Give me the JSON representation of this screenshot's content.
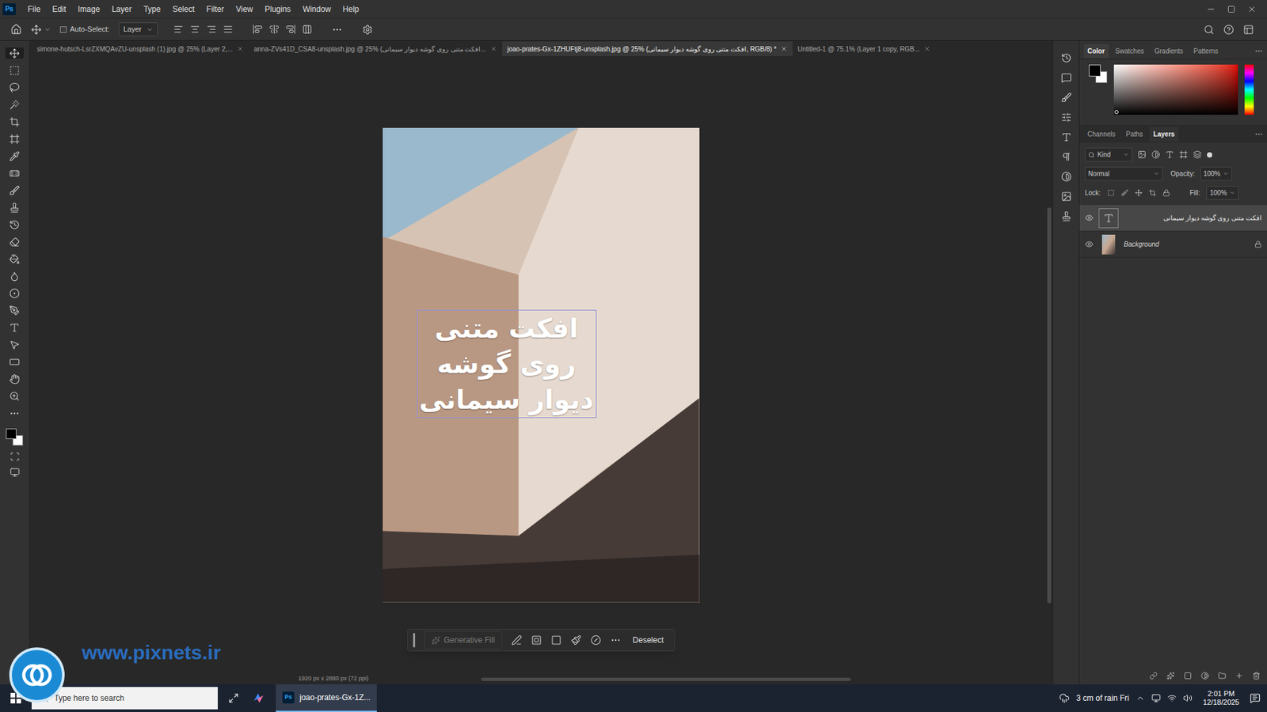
{
  "app_logo": "Ps",
  "menu": [
    "File",
    "Edit",
    "Image",
    "Layer",
    "Type",
    "Select",
    "Filter",
    "View",
    "Plugins",
    "Window",
    "Help"
  ],
  "options_bar": {
    "auto_select": {
      "label": "Auto-Select:",
      "checked": false
    },
    "target": "Layer"
  },
  "document_tabs": [
    {
      "label": "simone-hutsch-LsrZXMQAvZU-unsplash (1).jpg @ 25% (Layer 2,...",
      "selected": false
    },
    {
      "label": "anna-ZVs41D_CSA8-unsplash.jpg @ 25% (افکت متنی روی گوشه دیوار سیمانی...",
      "selected": false
    },
    {
      "label": "joao-prates-Gx-1ZHUFtj8-unsplash.jpg @ 25% (افکت متنی روی گوشه دیوار سیمانی, RGB/8) *",
      "selected": true
    },
    {
      "label": "Untitled-1 @ 75.1% (Layer 1 copy, RGB...",
      "selected": false
    }
  ],
  "canvas": {
    "text_layer": "افکت متنی روی گوشه دیوار سیمانی"
  },
  "contextual_taskbar": {
    "generative_fill": {
      "label": "Generative Fill",
      "disabled": true
    },
    "deselect": "Deselect"
  },
  "status_bar": "1920 px x 2880 px (72 ppi)",
  "color_panel": {
    "tabs": [
      {
        "label": "Color",
        "selected": true
      },
      {
        "label": "Swatches",
        "selected": false
      },
      {
        "label": "Gradients",
        "selected": false
      },
      {
        "label": "Patterns",
        "selected": false
      }
    ],
    "foreground": "#000000",
    "background": "#ffffff"
  },
  "layers_panel": {
    "tabs": [
      {
        "label": "Channels",
        "selected": false
      },
      {
        "label": "Paths",
        "selected": false
      },
      {
        "label": "Layers",
        "selected": true
      }
    ],
    "filter": "Kind",
    "blend_mode": "Normal",
    "opacity_label": "Opacity:",
    "opacity": "100%",
    "lock_label": "Lock:",
    "fill_label": "Fill:",
    "fill": "100%",
    "layers": [
      {
        "name": "افکت متنی روی گوشه دیوار سیمانی",
        "kind": "text",
        "selected": true,
        "visible": true,
        "locked": false
      },
      {
        "name": "Background",
        "kind": "image",
        "selected": false,
        "visible": true,
        "locked": true
      }
    ]
  },
  "watermark": "www.pixnets.ir",
  "taskbar": {
    "search_placeholder": "Type here to search",
    "apps": [
      {
        "label": "joao-prates-Gx-1Z...",
        "active": true
      }
    ],
    "weather": "3 cm of rain Fri",
    "time": "2:01 PM",
    "date": "12/18/2025"
  }
}
